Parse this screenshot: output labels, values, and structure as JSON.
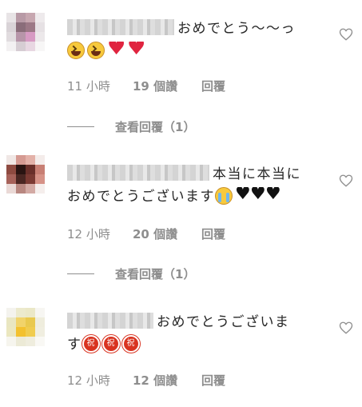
{
  "comments": [
    {
      "text": "おめでとう〜〜っ",
      "emoji": [
        "laughing-face-emoji",
        "laughing-face-emoji",
        "sparkling-heart-emoji",
        "sparkling-heart-emoji"
      ],
      "time": "11 小時",
      "likes": "19 個讚",
      "reply": "回覆",
      "view_replies": "查看回覆（1）"
    },
    {
      "text_line1": "本当に本当に",
      "text_line2": "おめでとうございます",
      "emoji": [
        "crying-face-emoji",
        "black-heart-emoji",
        "black-heart-emoji",
        "black-heart-emoji"
      ],
      "time": "12 小時",
      "likes": "20 個讚",
      "reply": "回覆",
      "view_replies": "查看回覆（1）"
    },
    {
      "text_line1": "おめでとうございま",
      "text_line2": "す",
      "emoji": [
        "congratulations-ideograph-emoji",
        "congratulations-ideograph-emoji",
        "congratulations-ideograph-emoji"
      ],
      "emoji_glyph": "祝",
      "time": "12 小時",
      "likes": "12 個讚",
      "reply": "回覆"
    }
  ],
  "colors": {
    "secondary_text": "#8e8e8e",
    "primary_text": "#262626",
    "heart_red": "#e0243f"
  },
  "icons": {
    "like": "heart-outline-icon"
  }
}
